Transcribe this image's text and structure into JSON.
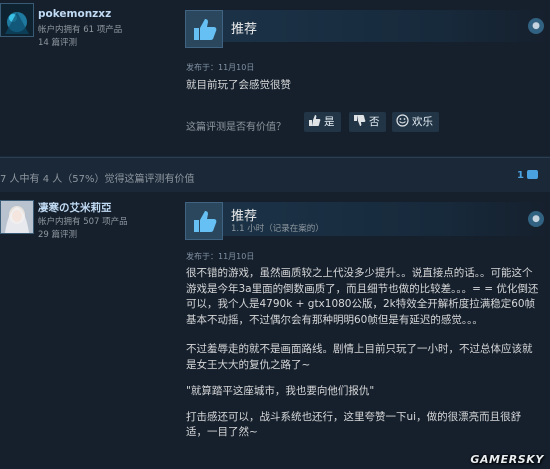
{
  "review1": {
    "username": "pokemonzxz",
    "products": "帐户内拥有 61 项产品",
    "reviews_count": "14 篇评测",
    "verdict": "推荐",
    "posted": "发布于：11月10日",
    "body": "就目前玩了会感觉很赞",
    "helpful_question": "这篇评测是否有价值？",
    "yes_label": "是",
    "no_label": "否",
    "funny_label": "欢乐"
  },
  "helpful_bar": {
    "text": "7 人中有 4 人（57%）觉得这篇评测有价值",
    "comment_count": "1"
  },
  "review2": {
    "username": "凄寒の艾米莉亞",
    "products": "帐户内拥有 507 项产品",
    "reviews_count": "29 篇评测",
    "verdict": "推荐",
    "hours": "1.1 小时（记录在案的）",
    "posted": "发布于：11月10日",
    "paragraphs": [
      "很不错的游戏，虽然画质较之上代没多少提升。。说直接点的话。。可能这个游戏是今年3a里面的倒数画质了，而且细节也做的比较差。。。= = 优化倒还可以，我个人是4790k + gtx1080公版，2k特效全开解析度拉满稳定60帧基本不动摇，不过偶尔会有那种明明60帧但是有延迟的感觉。。。",
      "不过羞辱走的就不是画面路线。剧情上目前只玩了一小时，不过总体应该就是女王大大的复仇之路了~",
      "\"就算踏平这座城市，我也要向他们报仇\"",
      "打击感还可以，战斗系统也还行，这里夸赞一下ui，做的很漂亮而且很舒适，一目了然~"
    ]
  },
  "watermark": "GAMERSKY",
  "icons": {
    "thumb": "thumbs-up-icon",
    "steam": "steam-logo-icon",
    "comment": "comment-bubble-icon"
  },
  "colors": {
    "background": "#1b2838",
    "panel": "#16202d",
    "username": "#c1dbf4",
    "link": "#4aa3e0"
  }
}
